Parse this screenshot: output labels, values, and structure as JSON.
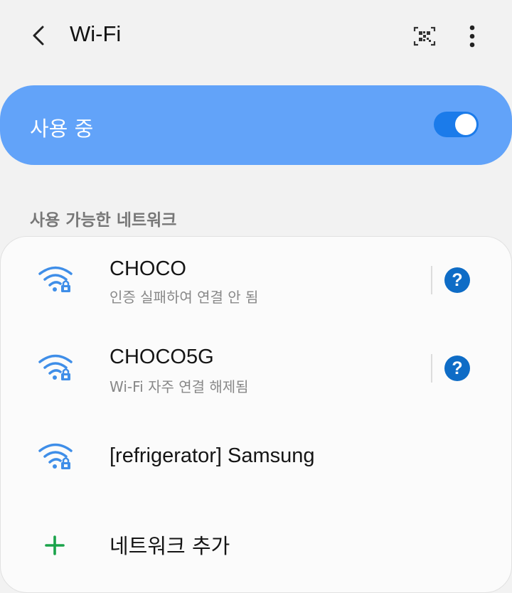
{
  "header": {
    "title": "Wi-Fi",
    "back_icon": "chevron-left-icon",
    "qr_icon": "qr-code-icon",
    "more_icon": "more-vertical-icon"
  },
  "master_switch": {
    "label": "사용 중",
    "state": "on",
    "color": "#62a3f9"
  },
  "section_title": "사용 가능한 네트워크",
  "networks": [
    {
      "name": "CHOCO",
      "status": "인증 실패하여 연결 안 됨",
      "secured": true,
      "help": "?"
    },
    {
      "name": "CHOCO5G",
      "status": "Wi-Fi 자주 연결 해제됨",
      "secured": true,
      "help": "?"
    },
    {
      "name": "[refrigerator] Samsung",
      "status": "",
      "secured": true
    }
  ],
  "add_network": {
    "label": "네트워크 추가",
    "icon": "plus-icon"
  },
  "colors": {
    "accent": "#1b7bea",
    "help": "#0e6cc6",
    "add": "#1aa34a"
  }
}
